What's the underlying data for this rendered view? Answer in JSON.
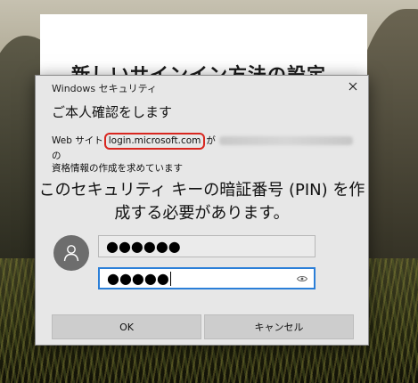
{
  "background_page": {
    "title": "新しいサインイン方法の設定"
  },
  "dialog": {
    "window_title": "Windows セキュリティ",
    "heading": "ご本人確認をします",
    "info_prefix": "Web サイト",
    "domain": "login.microsoft.com",
    "info_particle": "が",
    "info_email": "",
    "info_suffix_line1": "の",
    "info_line2": "資格情報の作成を求めています",
    "pin_message_line1": "このセキュリティ キーの暗証番号 (PIN) を作",
    "pin_message_line2": "成する必要があります。",
    "pin_value": "●●●●●●",
    "pin_confirm_value": "●●●●●",
    "ok_label": "OK",
    "cancel_label": "キャンセル",
    "icons": {
      "close": "close-icon",
      "avatar": "user-icon",
      "reveal": "eye-icon"
    }
  },
  "colors": {
    "highlight": "#d8261f",
    "focus": "#2b7fd8",
    "dialog_bg": "#e7e7e7"
  }
}
